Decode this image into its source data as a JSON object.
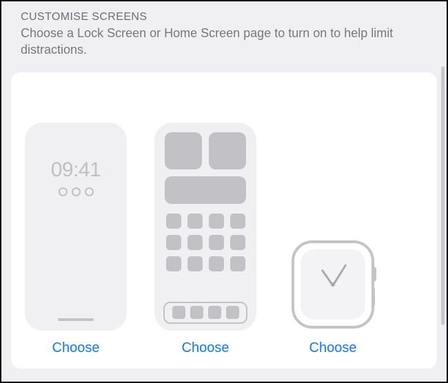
{
  "header": {
    "title": "CUSTOMISE SCREENS",
    "description": "Choose a Lock Screen or Home Screen page to turn on to help limit distractions."
  },
  "lockScreen": {
    "time": "09:41",
    "chooseLabel": "Choose"
  },
  "homeScreen": {
    "chooseLabel": "Choose"
  },
  "watch": {
    "chooseLabel": "Choose"
  },
  "colors": {
    "link": "#0b79ff",
    "placeholder": "#c1c1c6"
  }
}
